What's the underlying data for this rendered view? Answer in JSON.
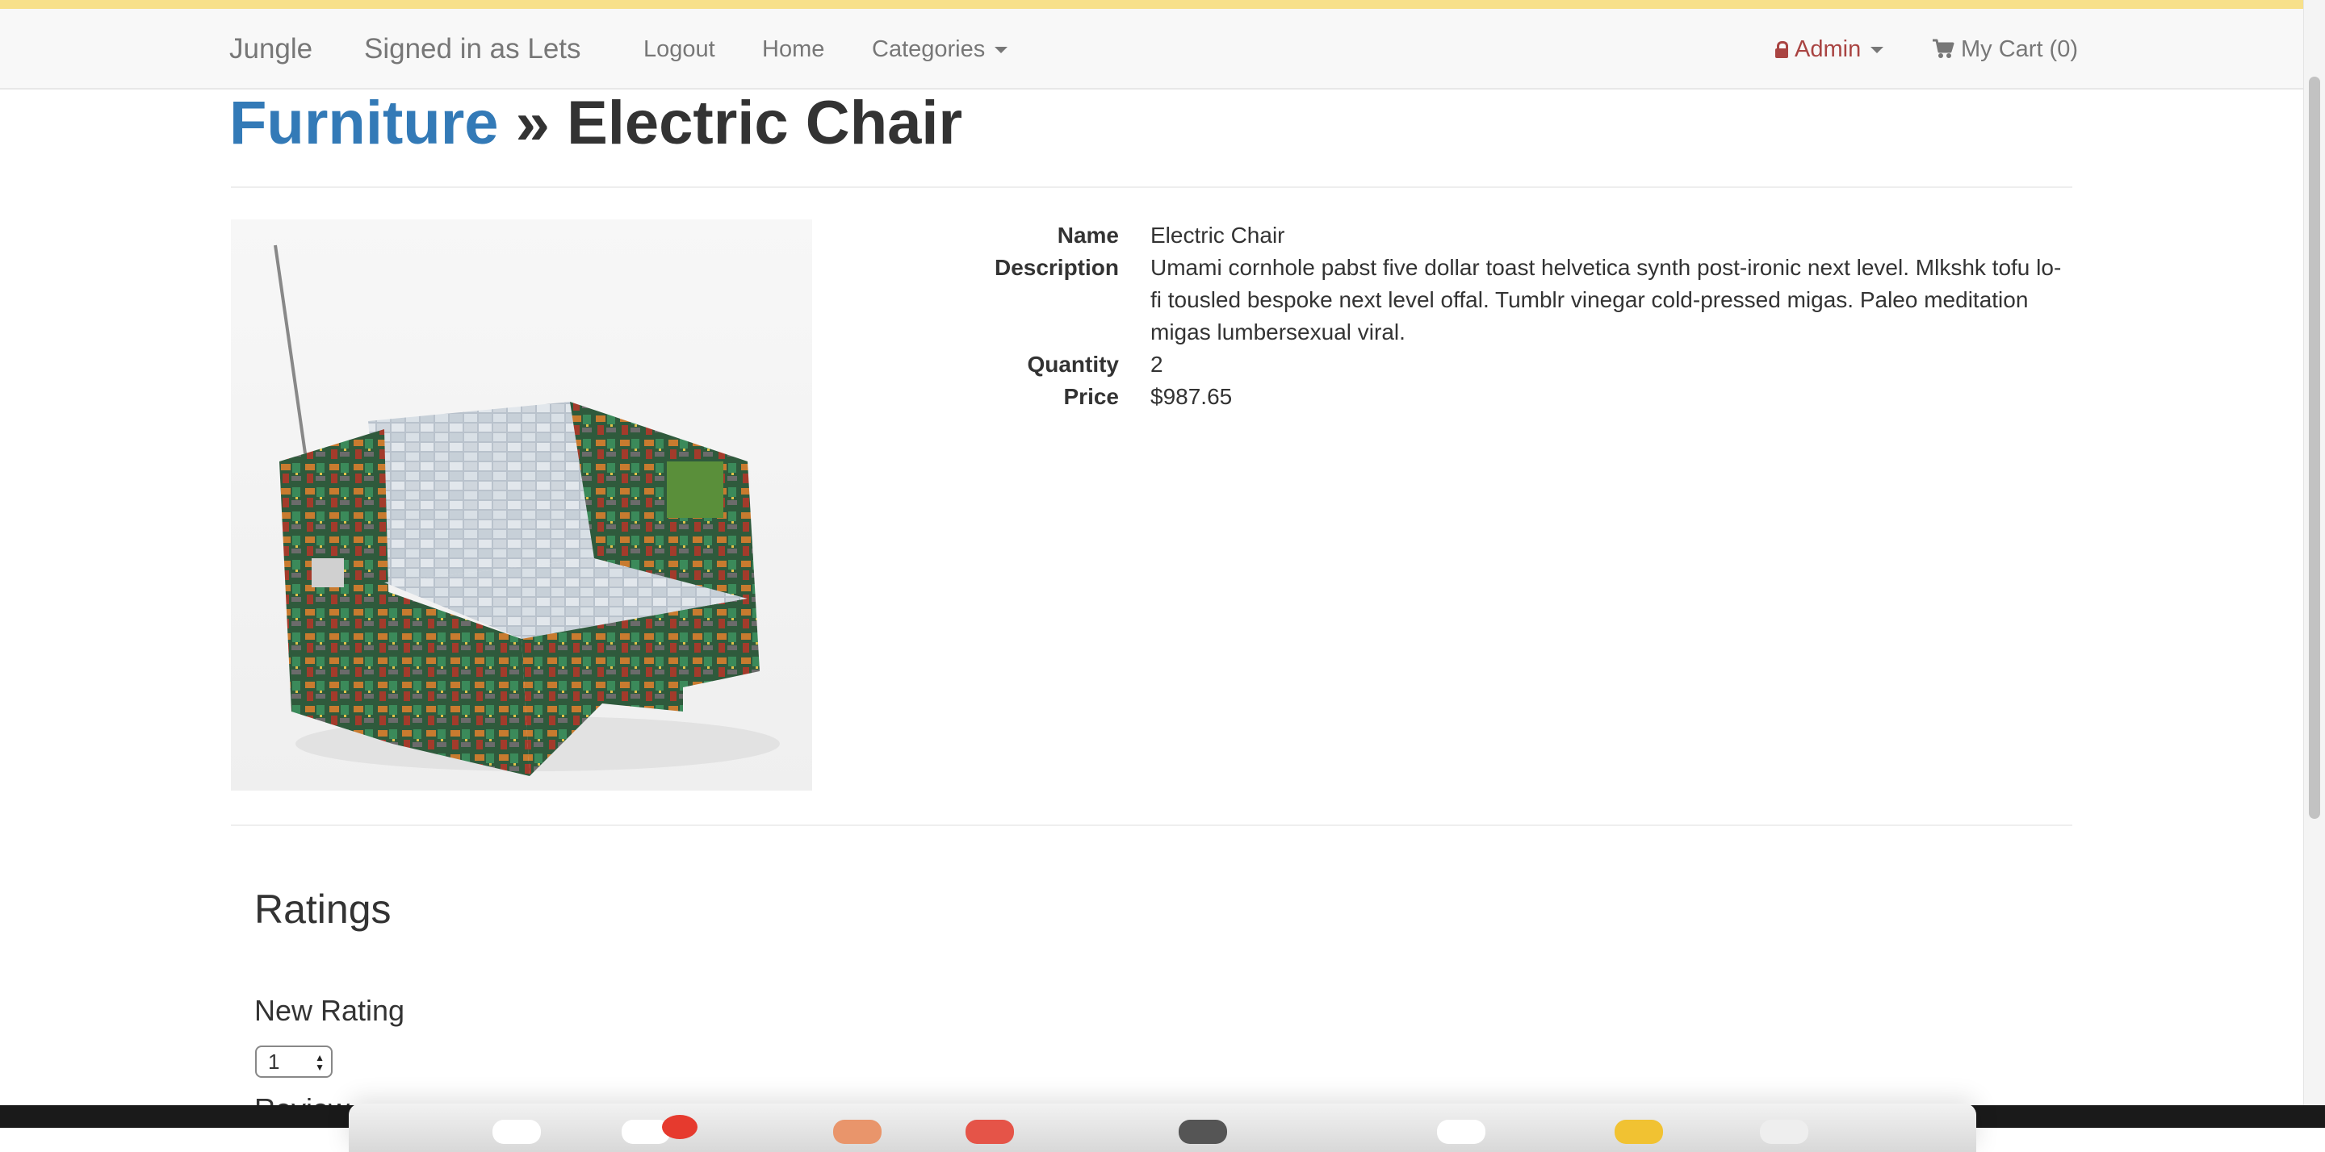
{
  "navbar": {
    "brand": "Jungle",
    "signed_in": "Signed in as Lets",
    "logout": "Logout",
    "home": "Home",
    "categories": "Categories",
    "admin": "Admin",
    "cart": "My Cart (0)"
  },
  "page": {
    "category_link": "Furniture",
    "separator": "»",
    "product_title": "Electric Chair"
  },
  "details": {
    "name_label": "Name",
    "name_value": "Electric Chair",
    "description_label": "Description",
    "description_value": "Umami cornhole pabst five dollar toast helvetica synth post-ironic next level. Mlkshk tofu lo-fi tousled bespoke next level offal. Tumblr vinegar cold-pressed migas. Paleo meditation migas lumbersexual viral.",
    "quantity_label": "Quantity",
    "quantity_value": "2",
    "price_label": "Price",
    "price_value": "$987.65"
  },
  "ratings": {
    "title": "Ratings",
    "new_rating_title": "New Rating",
    "selected_rating": "1",
    "review_title": "Review"
  },
  "colors": {
    "link": "#337ab7",
    "admin": "#a94442",
    "navbar_bg": "#f8f8f8",
    "top_stripe": "#f7e08a"
  },
  "icons": {
    "admin": "lock-icon",
    "cart": "shopping-cart-icon",
    "categories": "caret-down-icon"
  }
}
